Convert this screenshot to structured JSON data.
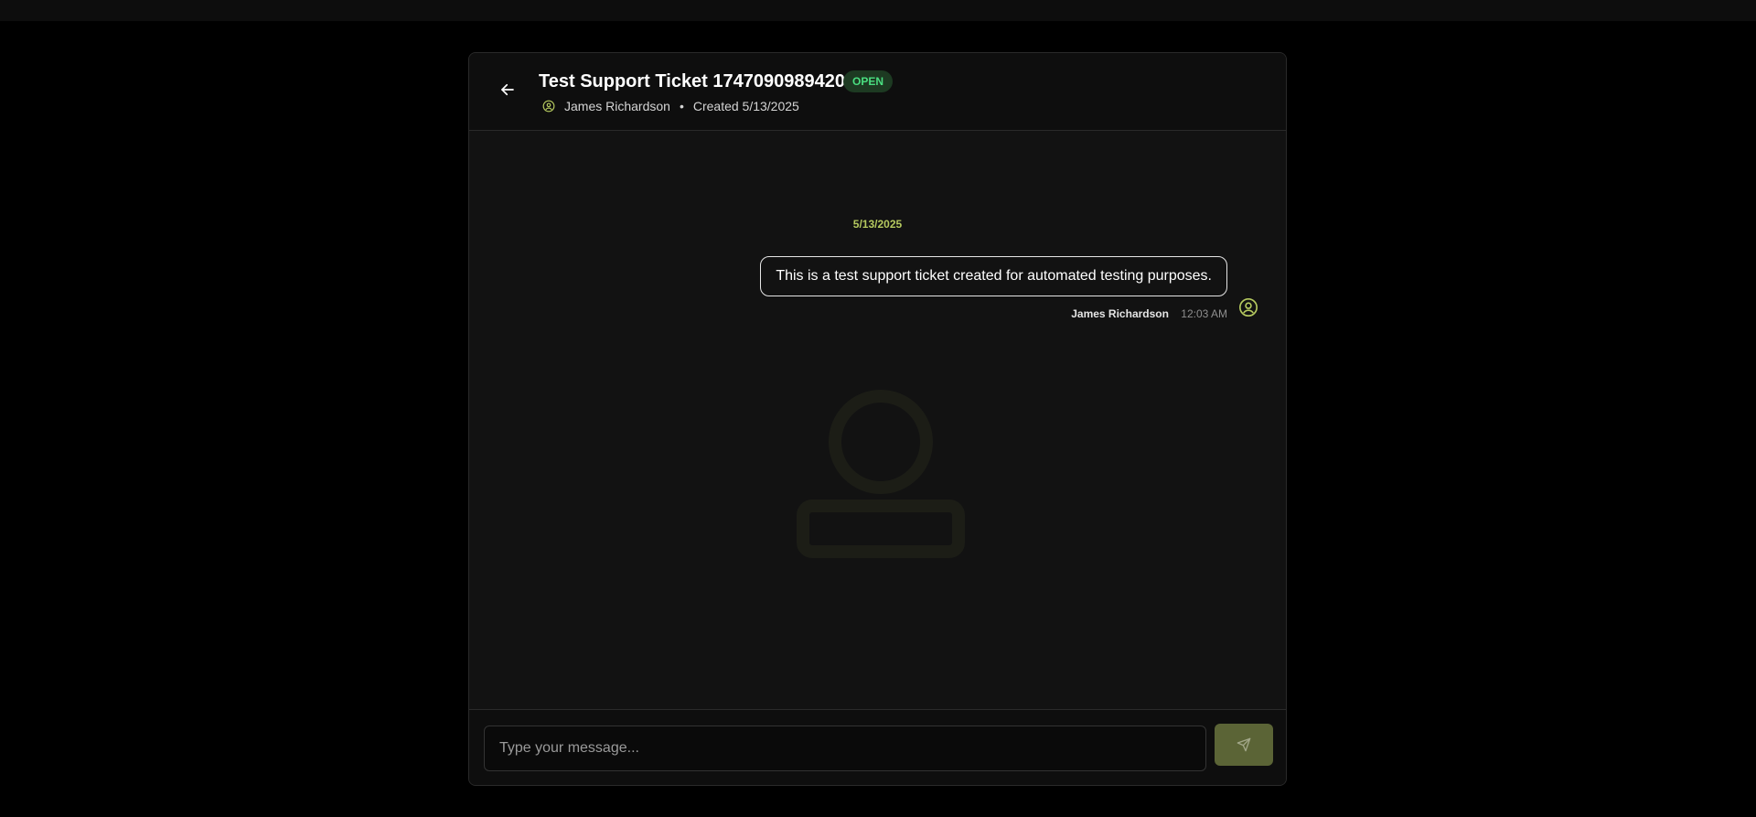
{
  "ticket": {
    "title": "Test Support Ticket 1747090989420",
    "status": "OPEN",
    "author": "James Richardson",
    "created": "Created 5/13/2025",
    "separator": "•"
  },
  "chat": {
    "date_separator": "5/13/2025",
    "messages": [
      {
        "text": "This is a test support ticket created for automated testing purposes.",
        "author": "James Richardson",
        "time": "12:03 AM"
      }
    ]
  },
  "composer": {
    "placeholder": "Type your message..."
  },
  "icons": {
    "back": "arrow-left-icon",
    "user": "user-circle-icon",
    "send": "send-icon"
  },
  "colors": {
    "accent": "#b5c95f",
    "status_text": "#4ade80",
    "status_bg": "#1d3a22",
    "send_button": "#5b6436"
  }
}
